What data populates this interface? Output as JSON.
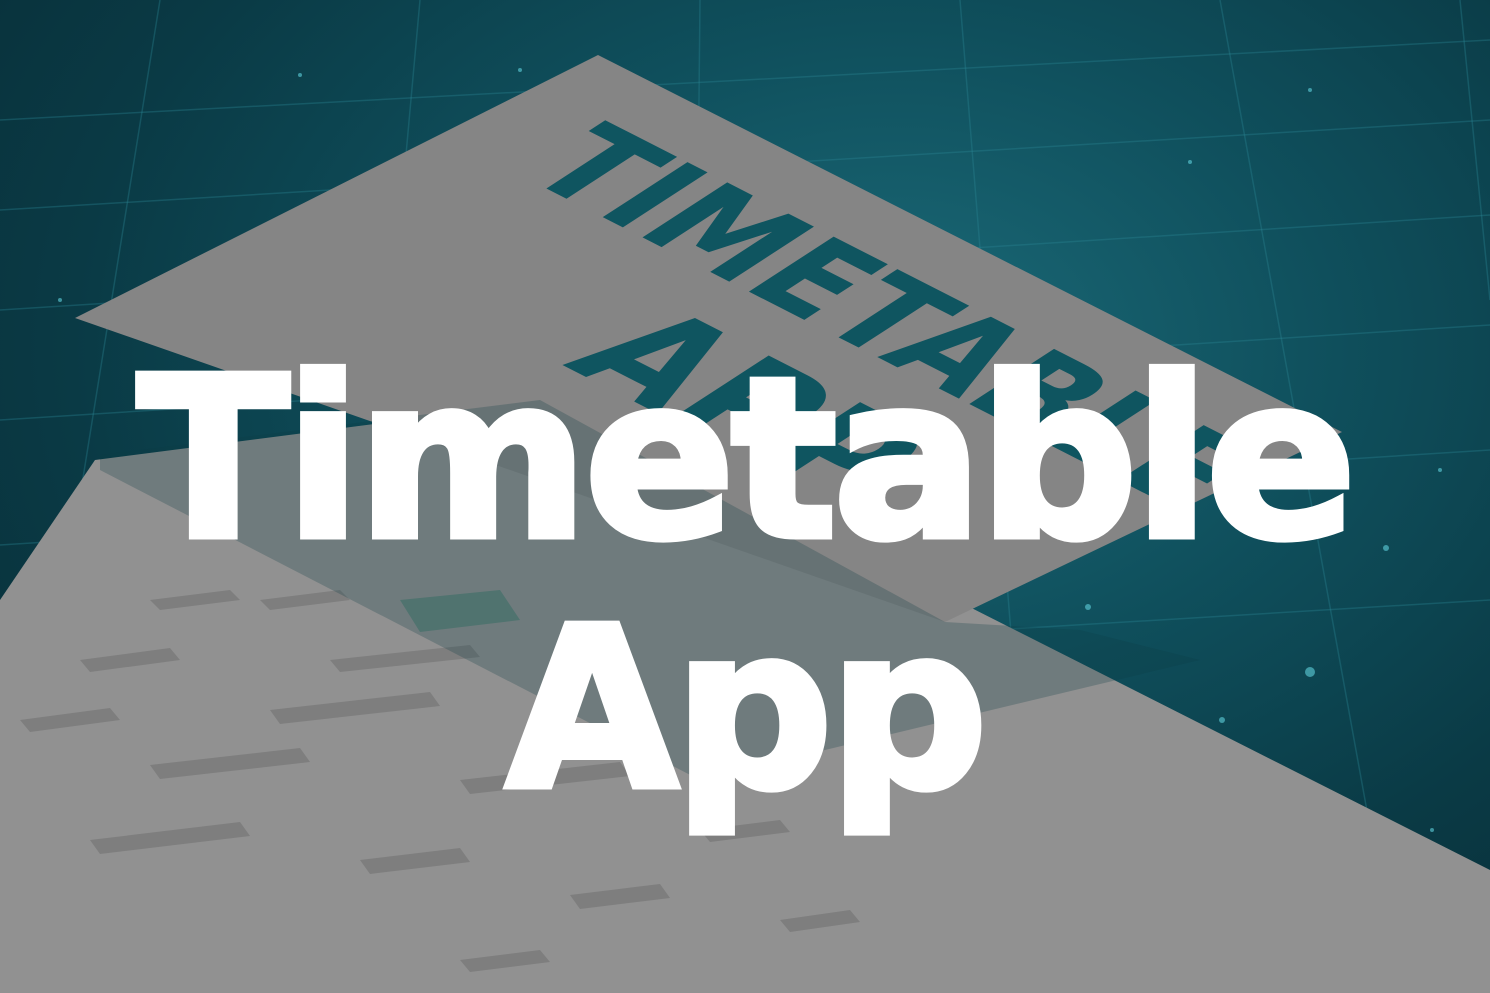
{
  "background": {
    "color_dark": "#072a33",
    "color_mid": "#0f4f5c",
    "color_light": "#1b6a78"
  },
  "card": {
    "logo_line1": "TIMETABLE",
    "logo_line2": "APP",
    "logo_color": "#0f5560",
    "card_color": "#8a8a8a"
  },
  "headline": {
    "line1": "Timetable",
    "line2": "App",
    "color": "#ffffff"
  }
}
